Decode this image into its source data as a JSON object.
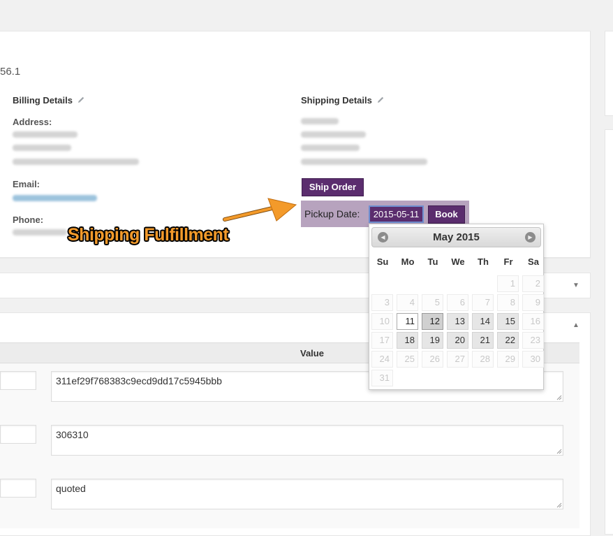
{
  "order": {
    "number_fragment": "56.1",
    "billing_heading": "Billing Details",
    "shipping_heading": "Shipping Details",
    "address_label": "Address:",
    "email_label": "Email:",
    "phone_label": "Phone:"
  },
  "shipping_actions": {
    "ship_order_label": "Ship Order",
    "pickup_label": "Pickup Date:",
    "pickup_value": "2015-05-11",
    "book_label": "Book"
  },
  "annotation": {
    "text": "Shipping Fulfillment",
    "color": "#f39a2a"
  },
  "custom_fields": {
    "value_header": "Value",
    "rows": [
      {
        "key": "",
        "value": "311ef29f768383c9ecd9dd17c5945bbb"
      },
      {
        "key": "",
        "value": "306310"
      },
      {
        "key": "",
        "value": "quoted"
      }
    ]
  },
  "datepicker": {
    "month_title": "May 2015",
    "prev_icon": "circle-triangle-w",
    "next_icon": "circle-triangle-e",
    "weekdays": [
      "Su",
      "Mo",
      "Tu",
      "We",
      "Th",
      "Fr",
      "Sa"
    ],
    "weeks": [
      [
        null,
        null,
        null,
        null,
        null,
        {
          "d": "1",
          "s": "other"
        },
        {
          "d": "2",
          "s": "other"
        }
      ],
      [
        {
          "d": "3",
          "s": "other"
        },
        {
          "d": "4",
          "s": "other"
        },
        {
          "d": "5",
          "s": "other"
        },
        {
          "d": "6",
          "s": "other"
        },
        {
          "d": "7",
          "s": "other"
        },
        {
          "d": "8",
          "s": "other"
        },
        {
          "d": "9",
          "s": "other"
        }
      ],
      [
        {
          "d": "10",
          "s": "other"
        },
        {
          "d": "11",
          "s": "today"
        },
        {
          "d": "12",
          "s": "selected"
        },
        {
          "d": "13",
          "s": "enabled"
        },
        {
          "d": "14",
          "s": "enabled"
        },
        {
          "d": "15",
          "s": "enabled"
        },
        {
          "d": "16",
          "s": "other"
        }
      ],
      [
        {
          "d": "17",
          "s": "other"
        },
        {
          "d": "18",
          "s": "enabled"
        },
        {
          "d": "19",
          "s": "enabled"
        },
        {
          "d": "20",
          "s": "enabled"
        },
        {
          "d": "21",
          "s": "enabled"
        },
        {
          "d": "22",
          "s": "enabled"
        },
        {
          "d": "23",
          "s": "other"
        }
      ],
      [
        {
          "d": "24",
          "s": "other"
        },
        {
          "d": "25",
          "s": "other"
        },
        {
          "d": "26",
          "s": "other"
        },
        {
          "d": "27",
          "s": "other"
        },
        {
          "d": "28",
          "s": "other"
        },
        {
          "d": "29",
          "s": "other"
        },
        {
          "d": "30",
          "s": "other"
        }
      ],
      [
        {
          "d": "31",
          "s": "other"
        },
        null,
        null,
        null,
        null,
        null,
        null
      ]
    ]
  },
  "colors": {
    "brand_purple": "#5b2d6e",
    "pickup_bg": "#b7a3be",
    "page_bg": "#f1f1f1"
  }
}
